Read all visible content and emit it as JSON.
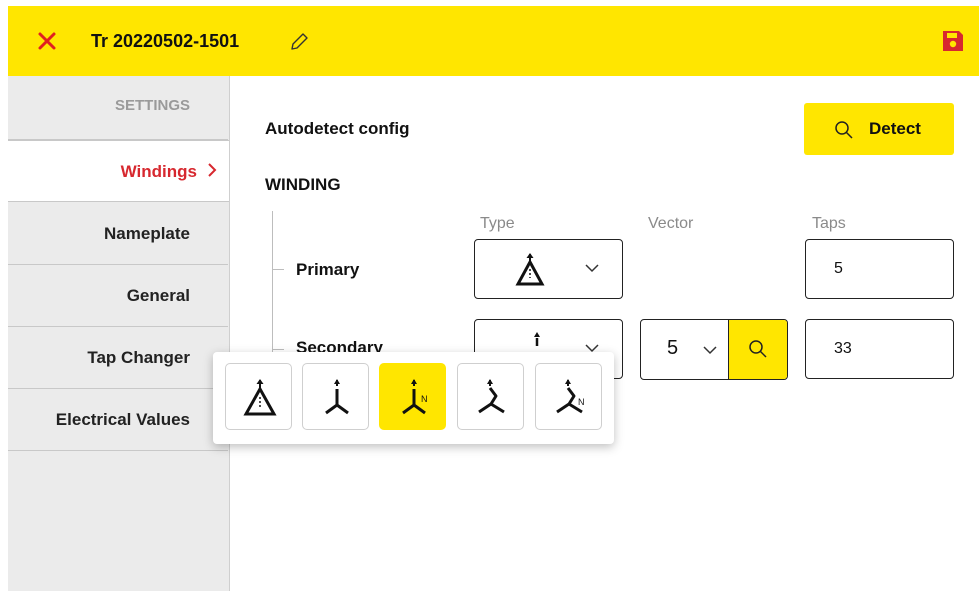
{
  "header": {
    "title": "Tr 20220502-1501",
    "accent": "#FFE600",
    "close_icon_color": "#e02020",
    "save_icon_color": "#d7282f"
  },
  "sidebar": {
    "header": "SETTINGS",
    "items": [
      {
        "label": "Windings",
        "active": true
      },
      {
        "label": "Nameplate"
      },
      {
        "label": "General"
      },
      {
        "label": "Tap Changer"
      },
      {
        "label": "Electrical Values"
      }
    ],
    "active_color": "#d7282f"
  },
  "main": {
    "autodetect_label": "Autodetect config",
    "detect_label": "Detect",
    "winding_heading": "WINDING",
    "columns": {
      "type": "Type",
      "vector": "Vector",
      "taps": "Taps"
    },
    "rows": [
      {
        "label": "Primary",
        "type_icon": "delta-icon",
        "taps": "5"
      },
      {
        "label": "Secondary",
        "type_icon": "wye-neutral-icon",
        "vector": "5",
        "taps": "33"
      }
    ]
  },
  "type_popup": {
    "options": [
      "delta-icon",
      "wye-icon",
      "wye-neutral-icon",
      "zigzag-icon",
      "zigzag-neutral-icon"
    ],
    "selected": "wye-neutral-icon",
    "neutral_mark": "N"
  }
}
